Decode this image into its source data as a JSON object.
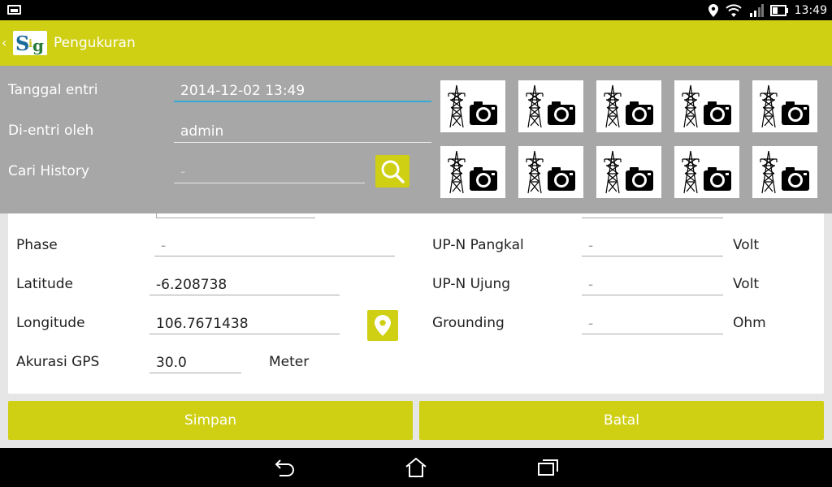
{
  "status": {
    "time": "13:49"
  },
  "app": {
    "title": "Pengukuran",
    "logo_text": "SIG"
  },
  "header_form": {
    "tanggal_label": "Tanggal entri",
    "tanggal_value": "2014-12-02 13:49",
    "dientri_label": "Di-entri oleh",
    "dientri_value": "admin",
    "cari_label": "Cari History",
    "cari_value": "-"
  },
  "form": {
    "phase_label": "Phase",
    "phase_value": "-",
    "latitude_label": "Latitude",
    "latitude_value": "-6.208738",
    "longitude_label": "Longitude",
    "longitude_value": "106.7671438",
    "akurasi_label": "Akurasi GPS",
    "akurasi_value": "30.0",
    "akurasi_unit": "Meter",
    "upn_pangkal_label": "UP-N Pangkal",
    "upn_pangkal_value": "-",
    "upn_pangkal_unit": "Volt",
    "upn_ujung_label": "UP-N Ujung",
    "upn_ujung_value": "-",
    "upn_ujung_unit": "Volt",
    "grounding_label": "Grounding",
    "grounding_value": "-",
    "grounding_unit": "Ohm"
  },
  "buttons": {
    "save": "Simpan",
    "cancel": "Batal"
  },
  "colors": {
    "accent": "#cfcf14",
    "overlay": "#a7a7a7",
    "focus": "#33a9d6"
  },
  "photos": {
    "count": 10,
    "icon": "tower-camera-icon"
  }
}
